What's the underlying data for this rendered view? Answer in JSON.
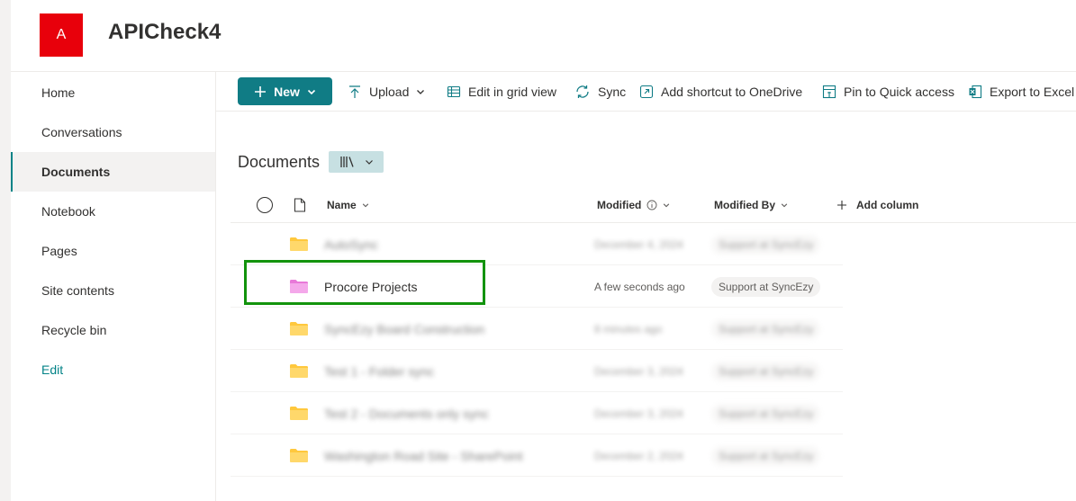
{
  "site": {
    "logo_letter": "A",
    "title": "APICheck4",
    "brand_color": "#e8000b"
  },
  "nav": {
    "items": [
      {
        "label": "Home"
      },
      {
        "label": "Conversations"
      },
      {
        "label": "Documents"
      },
      {
        "label": "Notebook"
      },
      {
        "label": "Pages"
      },
      {
        "label": "Site contents"
      },
      {
        "label": "Recycle bin"
      },
      {
        "label": "Edit"
      }
    ],
    "selected": "Documents"
  },
  "commands": {
    "new_label": "New",
    "upload_label": "Upload",
    "edit_grid_label": "Edit in grid view",
    "sync_label": "Sync",
    "shortcut_label": "Add shortcut to OneDrive",
    "pin_label": "Pin to Quick access",
    "export_label": "Export to Excel",
    "accent_color": "#107c85"
  },
  "library": {
    "title": "Documents",
    "view_icon": "library-view-icon"
  },
  "columns": {
    "name": "Name",
    "modified": "Modified",
    "modified_by": "Modified By",
    "add_column": "Add column"
  },
  "rows": [
    {
      "name": "AutoSync",
      "modified": "December 4, 2024",
      "modified_by": "Support at SyncEzy",
      "blurred": true
    },
    {
      "name": "Procore Projects",
      "modified": "A few seconds ago",
      "modified_by": "Support at SyncEzy",
      "blurred": false,
      "highlighted": true
    },
    {
      "name": "SyncEzy Board Construction",
      "modified": "8 minutes ago",
      "modified_by": "Support at SyncEzy",
      "blurred": true
    },
    {
      "name": "Test 1 - Folder sync",
      "modified": "December 3, 2024",
      "modified_by": "Support at SyncEzy",
      "blurred": true
    },
    {
      "name": "Test 2 - Documents only sync",
      "modified": "December 3, 2024",
      "modified_by": "Support at SyncEzy",
      "blurred": true
    },
    {
      "name": "Washington Road Site - SharePoint",
      "modified": "December 2, 2024",
      "modified_by": "Support at SyncEzy",
      "blurred": true
    }
  ]
}
